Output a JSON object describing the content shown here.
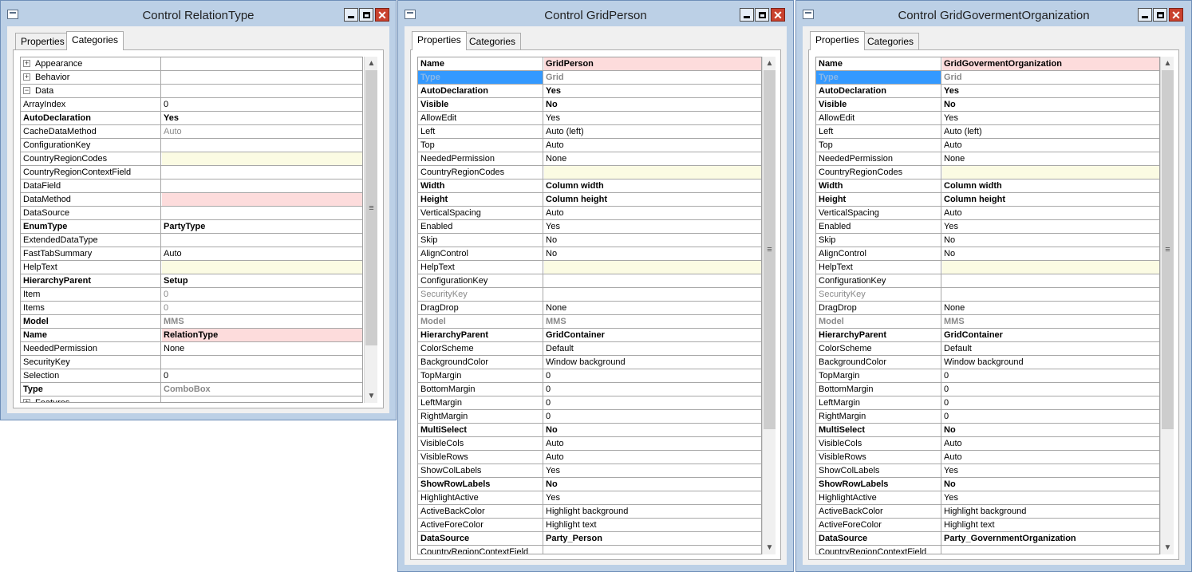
{
  "windows": [
    {
      "title": "Control RelationType",
      "tabs": [
        {
          "label": "Properties",
          "active": false
        },
        {
          "label": "Categories",
          "active": true
        }
      ],
      "rows": [
        {
          "name": "Appearance",
          "value": "",
          "expander": "+"
        },
        {
          "name": "Behavior",
          "value": "",
          "expander": "+"
        },
        {
          "name": "Data",
          "value": "",
          "expander": "−"
        },
        {
          "name": "ArrayIndex",
          "value": "0"
        },
        {
          "name": "AutoDeclaration",
          "value": "Yes",
          "bold": true
        },
        {
          "name": "CacheDataMethod",
          "value": "Auto",
          "value_style": "gray"
        },
        {
          "name": "ConfigurationKey",
          "value": ""
        },
        {
          "name": "CountryRegionCodes",
          "value": "",
          "value_style": "yellow"
        },
        {
          "name": "CountryRegionContextField",
          "value": ""
        },
        {
          "name": "DataField",
          "value": ""
        },
        {
          "name": "DataMethod",
          "value": "",
          "value_style": "pink"
        },
        {
          "name": "DataSource",
          "value": ""
        },
        {
          "name": "EnumType",
          "value": "PartyType",
          "bold": true
        },
        {
          "name": "ExtendedDataType",
          "value": ""
        },
        {
          "name": "FastTabSummary",
          "value": "Auto"
        },
        {
          "name": "HelpText",
          "value": "",
          "value_style": "yellow"
        },
        {
          "name": "HierarchyParent",
          "value": "Setup",
          "bold": true
        },
        {
          "name": "Item",
          "value": "0",
          "value_style": "gray"
        },
        {
          "name": "Items",
          "value": "0",
          "value_style": "gray"
        },
        {
          "name": "Model",
          "value": "MMS",
          "bold": true,
          "value_style": "gray"
        },
        {
          "name": "Name",
          "value": "RelationType",
          "bold": true,
          "value_style": "pink"
        },
        {
          "name": "NeededPermission",
          "value": "None"
        },
        {
          "name": "SecurityKey",
          "value": ""
        },
        {
          "name": "Selection",
          "value": "0"
        },
        {
          "name": "Type",
          "value": "ComboBox",
          "bold": true,
          "value_style": "gray"
        },
        {
          "name": "Features",
          "value": "",
          "expander": "+"
        }
      ]
    },
    {
      "title": "Control GridPerson",
      "tabs": [
        {
          "label": "Properties",
          "active": true
        },
        {
          "label": "Categories",
          "active": false
        }
      ],
      "rows": [
        {
          "name": "Name",
          "value": "GridPerson",
          "bold": true,
          "value_style": "pink"
        },
        {
          "name": "Type",
          "value": "Grid",
          "bold": true,
          "selected": true,
          "value_style": "gray"
        },
        {
          "name": "AutoDeclaration",
          "value": "Yes",
          "bold": true
        },
        {
          "name": "Visible",
          "value": "No",
          "bold": true
        },
        {
          "name": "AllowEdit",
          "value": "Yes"
        },
        {
          "name": "Left",
          "value": "Auto (left)"
        },
        {
          "name": "Top",
          "value": "Auto"
        },
        {
          "name": "NeededPermission",
          "value": "None"
        },
        {
          "name": "CountryRegionCodes",
          "value": "",
          "value_style": "yellow"
        },
        {
          "name": "Width",
          "value": "Column width",
          "bold": true
        },
        {
          "name": "Height",
          "value": "Column height",
          "bold": true
        },
        {
          "name": "VerticalSpacing",
          "value": "Auto"
        },
        {
          "name": "Enabled",
          "value": "Yes"
        },
        {
          "name": "Skip",
          "value": "No"
        },
        {
          "name": "AlignControl",
          "value": "No"
        },
        {
          "name": "HelpText",
          "value": "",
          "value_style": "yellow"
        },
        {
          "name": "ConfigurationKey",
          "value": ""
        },
        {
          "name": "SecurityKey",
          "value": "",
          "gray": true
        },
        {
          "name": "DragDrop",
          "value": "None"
        },
        {
          "name": "Model",
          "value": "MMS",
          "bold": true,
          "gray": true
        },
        {
          "name": "HierarchyParent",
          "value": "GridContainer",
          "bold": true
        },
        {
          "name": "ColorScheme",
          "value": "Default"
        },
        {
          "name": "BackgroundColor",
          "value": "Window background"
        },
        {
          "name": "TopMargin",
          "value": "0"
        },
        {
          "name": "BottomMargin",
          "value": "0"
        },
        {
          "name": "LeftMargin",
          "value": "0"
        },
        {
          "name": "RightMargin",
          "value": "0"
        },
        {
          "name": "MultiSelect",
          "value": "No",
          "bold": true
        },
        {
          "name": "VisibleCols",
          "value": "Auto"
        },
        {
          "name": "VisibleRows",
          "value": "Auto"
        },
        {
          "name": "ShowColLabels",
          "value": "Yes"
        },
        {
          "name": "ShowRowLabels",
          "value": "No",
          "bold": true
        },
        {
          "name": "HighlightActive",
          "value": "Yes"
        },
        {
          "name": "ActiveBackColor",
          "value": "Highlight background"
        },
        {
          "name": "ActiveForeColor",
          "value": "Highlight text"
        },
        {
          "name": "DataSource",
          "value": "Party_Person",
          "bold": true
        },
        {
          "name": "CountryRegionContextField",
          "value": ""
        }
      ]
    },
    {
      "title": "Control GridGovermentOrganization",
      "tabs": [
        {
          "label": "Properties",
          "active": true
        },
        {
          "label": "Categories",
          "active": false
        }
      ],
      "rows": [
        {
          "name": "Name",
          "value": "GridGovermentOrganization",
          "bold": true,
          "value_style": "pink"
        },
        {
          "name": "Type",
          "value": "Grid",
          "bold": true,
          "selected": true,
          "value_style": "gray"
        },
        {
          "name": "AutoDeclaration",
          "value": "Yes",
          "bold": true
        },
        {
          "name": "Visible",
          "value": "No",
          "bold": true
        },
        {
          "name": "AllowEdit",
          "value": "Yes"
        },
        {
          "name": "Left",
          "value": "Auto (left)"
        },
        {
          "name": "Top",
          "value": "Auto"
        },
        {
          "name": "NeededPermission",
          "value": "None"
        },
        {
          "name": "CountryRegionCodes",
          "value": "",
          "value_style": "yellow"
        },
        {
          "name": "Width",
          "value": "Column width",
          "bold": true
        },
        {
          "name": "Height",
          "value": "Column height",
          "bold": true
        },
        {
          "name": "VerticalSpacing",
          "value": "Auto"
        },
        {
          "name": "Enabled",
          "value": "Yes"
        },
        {
          "name": "Skip",
          "value": "No"
        },
        {
          "name": "AlignControl",
          "value": "No"
        },
        {
          "name": "HelpText",
          "value": "",
          "value_style": "yellow"
        },
        {
          "name": "ConfigurationKey",
          "value": ""
        },
        {
          "name": "SecurityKey",
          "value": "",
          "gray": true
        },
        {
          "name": "DragDrop",
          "value": "None"
        },
        {
          "name": "Model",
          "value": "MMS",
          "bold": true,
          "gray": true
        },
        {
          "name": "HierarchyParent",
          "value": "GridContainer",
          "bold": true
        },
        {
          "name": "ColorScheme",
          "value": "Default"
        },
        {
          "name": "BackgroundColor",
          "value": "Window background"
        },
        {
          "name": "TopMargin",
          "value": "0"
        },
        {
          "name": "BottomMargin",
          "value": "0"
        },
        {
          "name": "LeftMargin",
          "value": "0"
        },
        {
          "name": "RightMargin",
          "value": "0"
        },
        {
          "name": "MultiSelect",
          "value": "No",
          "bold": true
        },
        {
          "name": "VisibleCols",
          "value": "Auto"
        },
        {
          "name": "VisibleRows",
          "value": "Auto"
        },
        {
          "name": "ShowColLabels",
          "value": "Yes"
        },
        {
          "name": "ShowRowLabels",
          "value": "No",
          "bold": true
        },
        {
          "name": "HighlightActive",
          "value": "Yes"
        },
        {
          "name": "ActiveBackColor",
          "value": "Highlight background"
        },
        {
          "name": "ActiveForeColor",
          "value": "Highlight text"
        },
        {
          "name": "DataSource",
          "value": "Party_GovernmentOrganization",
          "bold": true
        },
        {
          "name": "CountryRegionContextField",
          "value": ""
        }
      ]
    }
  ],
  "title_buttons": {
    "minimize_icon": "minimize-icon",
    "maximize_icon": "maximize-icon",
    "close_icon": "close-icon"
  },
  "colors": {
    "selection": "#3399ff",
    "mandatory_value": "#fddcdc",
    "optional_value": "#fbfbe3",
    "close_button": "#c9412e"
  }
}
